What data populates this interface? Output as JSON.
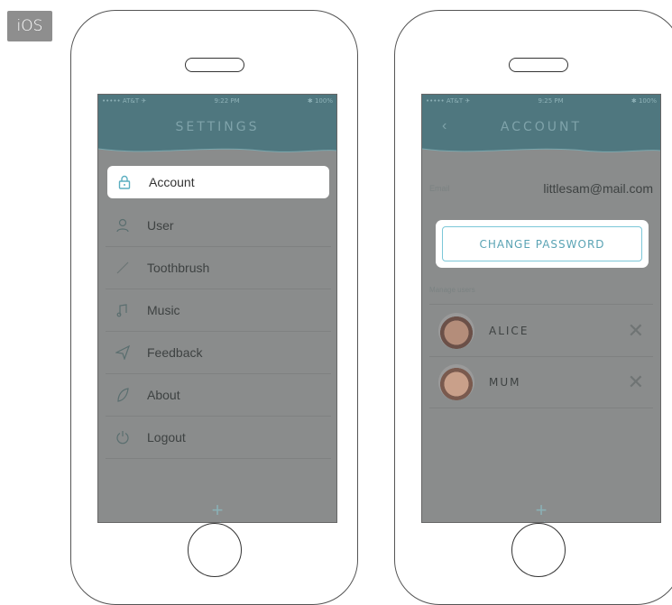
{
  "badge": "iOS",
  "settings_screen": {
    "status": {
      "carrier": "••••• AT&T ✈",
      "time": "9:22 PM",
      "battery": "✱ 100%"
    },
    "title": "SETTINGS",
    "items": [
      {
        "label": "Account",
        "icon": "lock-icon",
        "glyph": "🔒"
      },
      {
        "label": "User",
        "icon": "user-icon",
        "glyph": "👤"
      },
      {
        "label": "Toothbrush",
        "icon": "toothbrush-icon",
        "glyph": "⟋"
      },
      {
        "label": "Music",
        "icon": "music-icon",
        "glyph": "♫"
      },
      {
        "label": "Feedback",
        "icon": "send-icon",
        "glyph": "➚"
      },
      {
        "label": "About",
        "icon": "leaf-icon",
        "glyph": "❦"
      },
      {
        "label": "Logout",
        "icon": "power-icon",
        "glyph": "⏻"
      }
    ],
    "plus": "+"
  },
  "account_screen": {
    "status": {
      "carrier": "••••• AT&T ✈",
      "time": "9:25 PM",
      "battery": "✱ 100%"
    },
    "back": "‹",
    "title": "ACCOUNT",
    "email_label": "Email",
    "email_value": "littlesam@mail.com",
    "change_password": "CHANGE PASSWORD",
    "manage_users_label": "Manage users",
    "users": [
      {
        "name": "ALICE",
        "remove": "✕"
      },
      {
        "name": "MUM",
        "remove": "✕"
      }
    ],
    "plus": "+"
  },
  "colors": {
    "navbar": "#4f777f",
    "overlay": "#8a8c8c",
    "accent": "#7cc7d8"
  }
}
